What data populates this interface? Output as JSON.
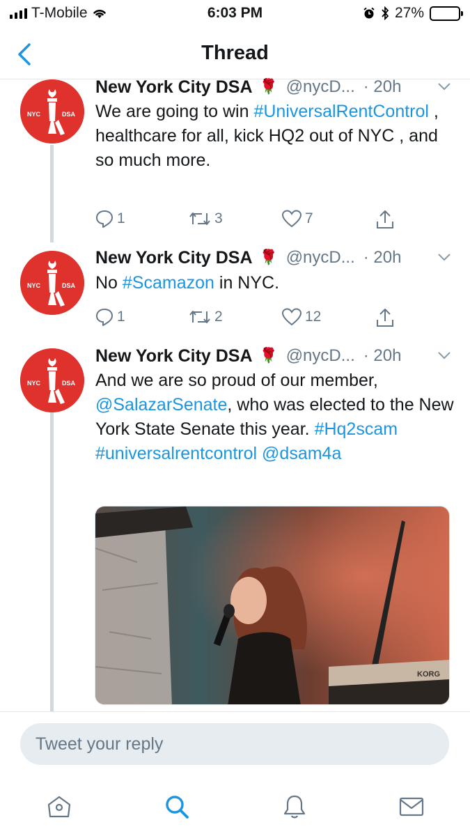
{
  "status_bar": {
    "carrier": "T-Mobile",
    "time": "6:03 PM",
    "battery_percent": "27%",
    "battery_level": 0.27,
    "signal_bars": 4,
    "icons": [
      "signal-icon",
      "wifi-icon",
      "alarm-icon",
      "bluetooth-icon",
      "battery-icon"
    ]
  },
  "nav": {
    "title": "Thread",
    "back_icon": "chevron-left-icon"
  },
  "avatar_text": {
    "left": "NYC",
    "right": "DSA"
  },
  "tweets": [
    {
      "name": "New York City DSA",
      "emoji": "🌹",
      "handle": "@nycD...",
      "time": "· 20h",
      "body": [
        {
          "text": "We are going to win ",
          "type": "text"
        },
        {
          "text": "#UniversalRentControl",
          "type": "link"
        },
        {
          "text": " , healthcare for all, kick HQ2 out of NYC , and so much more.",
          "type": "text"
        }
      ],
      "replies": "1",
      "retweets": "3",
      "likes": "7"
    },
    {
      "name": "New York City DSA",
      "emoji": "🌹",
      "handle": "@nycD...",
      "time": "· 20h",
      "body": [
        {
          "text": "No ",
          "type": "text"
        },
        {
          "text": "#Scamazon",
          "type": "link"
        },
        {
          "text": " in NYC.",
          "type": "text"
        }
      ],
      "replies": "1",
      "retweets": "2",
      "likes": "12"
    },
    {
      "name": "New York City DSA",
      "emoji": "🌹",
      "handle": "@nycD...",
      "time": "· 20h",
      "body": [
        {
          "text": "And we are so proud of our member, ",
          "type": "text"
        },
        {
          "text": "@SalazarSenate",
          "type": "link"
        },
        {
          "text": ", who was elected to the New York State Senate this year. ",
          "type": "text"
        },
        {
          "text": "#Hq2scam",
          "type": "link"
        },
        {
          "text": " ",
          "type": "text"
        },
        {
          "text": "#universalrentcontrol",
          "type": "link"
        },
        {
          "text": " ",
          "type": "text"
        },
        {
          "text": "@dsam4a",
          "type": "link"
        }
      ],
      "media_label": "KORG"
    }
  ],
  "reply": {
    "placeholder": "Tweet your reply"
  },
  "tabs": [
    {
      "name": "home",
      "icon": "home-icon"
    },
    {
      "name": "search",
      "icon": "search-icon",
      "active": true
    },
    {
      "name": "notifications",
      "icon": "bell-icon"
    },
    {
      "name": "messages",
      "icon": "mail-icon"
    }
  ],
  "colors": {
    "accent": "#1b95e0",
    "avatar_red": "#e0322d",
    "muted": "#657786",
    "thread_line": "#d2d9de"
  }
}
